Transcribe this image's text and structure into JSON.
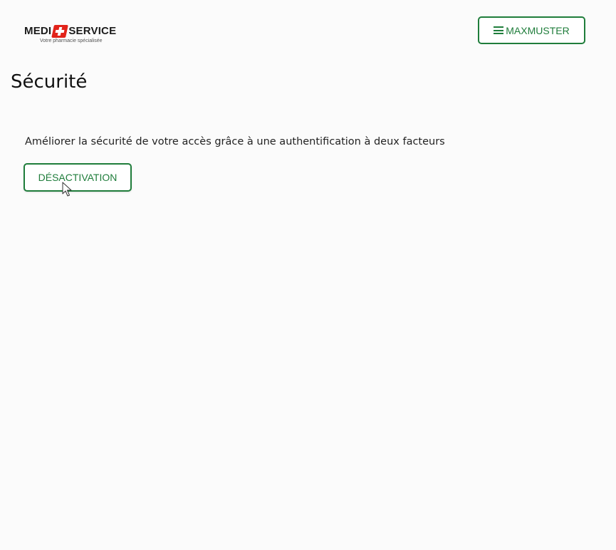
{
  "header": {
    "logo": {
      "text_left": "MEDI",
      "text_right": "SERVICE",
      "tagline": "Votre pharmacie spécialisée"
    },
    "user_menu": {
      "label": "MAXMUSTER",
      "icon": "hamburger-menu-icon"
    }
  },
  "main": {
    "title": "Sécurité",
    "description": "Améliorer la sécurité de votre accès grâce à une authentification à deux facteurs",
    "deactivate_label": "DÉSACTIVATION"
  },
  "colors": {
    "brand_green": "#1f7d3b",
    "brand_red": "#e2231a",
    "background": "#fbfbfb"
  }
}
